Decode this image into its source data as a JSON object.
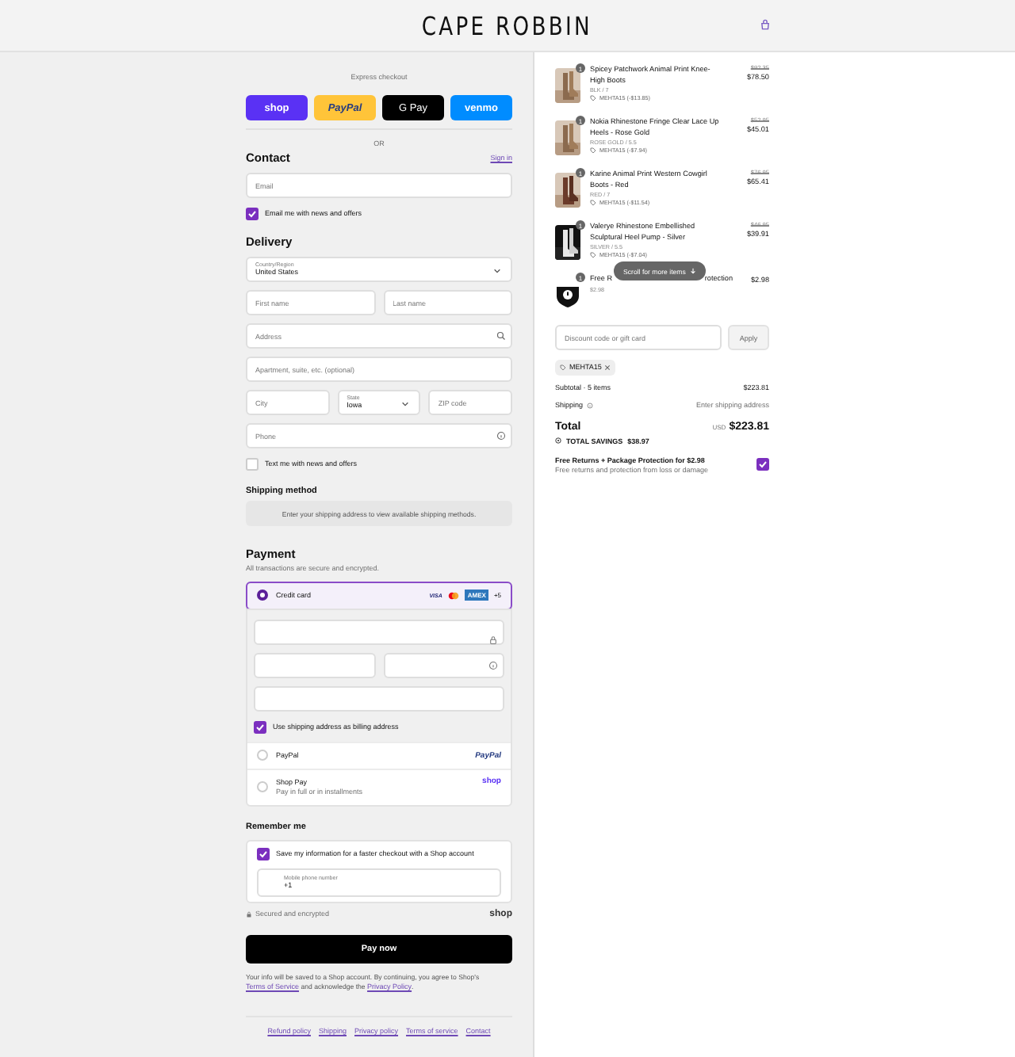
{
  "header": {
    "logo": "CAPE ROBBIN"
  },
  "express": {
    "label": "Express checkout",
    "or": "OR",
    "buttons": [
      {
        "label": "shop",
        "kind": "shop"
      },
      {
        "label": "PayPal",
        "kind": "paypal"
      },
      {
        "label": "G Pay",
        "kind": "gpay"
      },
      {
        "label": "venmo",
        "kind": "venmo"
      }
    ]
  },
  "contact": {
    "title": "Contact",
    "sign_in": "Sign in",
    "email": {
      "placeholder": "Email"
    },
    "news": {
      "label": "Email me with news and offers",
      "checked": true
    }
  },
  "delivery": {
    "title": "Delivery",
    "country": {
      "label": "Country/Region",
      "value": "United States"
    },
    "first_name": {
      "placeholder": "First name"
    },
    "last_name": {
      "placeholder": "Last name"
    },
    "address": {
      "placeholder": "Address"
    },
    "apartment": {
      "placeholder": "Apartment, suite, etc. (optional)"
    },
    "city": {
      "placeholder": "City"
    },
    "state": {
      "label": "State",
      "value": "Iowa"
    },
    "zip": {
      "placeholder": "ZIP code"
    },
    "phone": {
      "placeholder": "Phone"
    },
    "text_me": {
      "label": "Text me with news and offers",
      "checked": false
    }
  },
  "shipping_method": {
    "title": "Shipping method",
    "message": "Enter your shipping address to view available shipping methods."
  },
  "payment": {
    "title": "Payment",
    "subtitle": "All transactions are secure and encrypted.",
    "card_brands": {
      "visa": "VISA",
      "amex": "AMEX",
      "more": "+5"
    },
    "billing": {
      "label": "Use shipping address as billing address",
      "checked": true
    },
    "methods": [
      {
        "kind": "card",
        "label": "Credit card",
        "selected": true
      },
      {
        "kind": "paypal",
        "label": "PayPal",
        "brand": "PayPal",
        "selected": false
      },
      {
        "kind": "shoppay",
        "label": "Shop Pay",
        "sublabel": "Pay in full or in installments",
        "brand": "shop",
        "selected": false
      }
    ]
  },
  "remember": {
    "title": "Remember me",
    "save": {
      "label": "Save my information for a faster checkout with a Shop account",
      "checked": true
    },
    "mobile": {
      "label": "Mobile phone number",
      "value": "+1"
    }
  },
  "secured": "Secured and encrypted",
  "shop_mark": "shop",
  "pay_button": "Pay now",
  "notice": {
    "text": "Your info will be saved to a Shop account. By continuing, you agree to Shop's",
    "terms": "Terms of Service",
    "middle": "and acknowledge the",
    "privacy": "Privacy Policy",
    "end": "."
  },
  "footer_links": [
    "Refund policy",
    "Shipping",
    "Privacy policy",
    "Terms of service",
    "Contact"
  ],
  "summary": {
    "items": [
      {
        "kind": "product",
        "quantity": "1",
        "name": "Spicey Patchwork Animal Print Knee-High Boots",
        "variant": "BLK / 7",
        "discount": "MEHTA15 (-$13.85)",
        "old_price": "$92.35",
        "price": "$78.50"
      },
      {
        "kind": "product",
        "quantity": "1",
        "name": "Nokia Rhinestone Fringe Clear Lace Up Heels - Rose Gold",
        "variant": "ROSE GOLD / 5.5",
        "discount": "MEHTA15 (-$7.94)",
        "old_price": "$52.95",
        "price": "$45.01"
      },
      {
        "kind": "product",
        "quantity": "1",
        "name": "Karine Animal Print Western Cowgirl Boots - Red",
        "variant": "RED / 7",
        "discount": "MEHTA15 (-$11.54)",
        "old_price": "$76.95",
        "price": "$65.41"
      },
      {
        "kind": "product",
        "quantity": "1",
        "name": "Valerye Rhinestone Embellished Sculptural Heel Pump - Silver",
        "variant": "SILVER / 5.5",
        "discount": "MEHTA15 (-$7.04)",
        "old_price": "$46.95",
        "price": "$39.91"
      },
      {
        "kind": "protection",
        "quantity": "1",
        "name_start": "Free R",
        "name_end": "rotection",
        "variant": "$2.98",
        "price": "$2.98"
      }
    ],
    "tooltip": "Scroll for more items",
    "discount": {
      "placeholder": "Discount code or gift card",
      "apply": "Apply"
    },
    "code": "MEHTA15",
    "subtotal": {
      "label": "Subtotal · 5 items",
      "value": "$223.81"
    },
    "shipping": {
      "label": "Shipping",
      "value": "Enter shipping address"
    },
    "total": {
      "label": "Total",
      "currency": "USD",
      "value": "$223.81"
    },
    "savings": {
      "label": "TOTAL SAVINGS",
      "value": "$38.97"
    },
    "upsell": {
      "title": "Free Returns + Package Protection for $2.98",
      "description": "Free returns and protection from loss or damage",
      "checked": true
    }
  }
}
